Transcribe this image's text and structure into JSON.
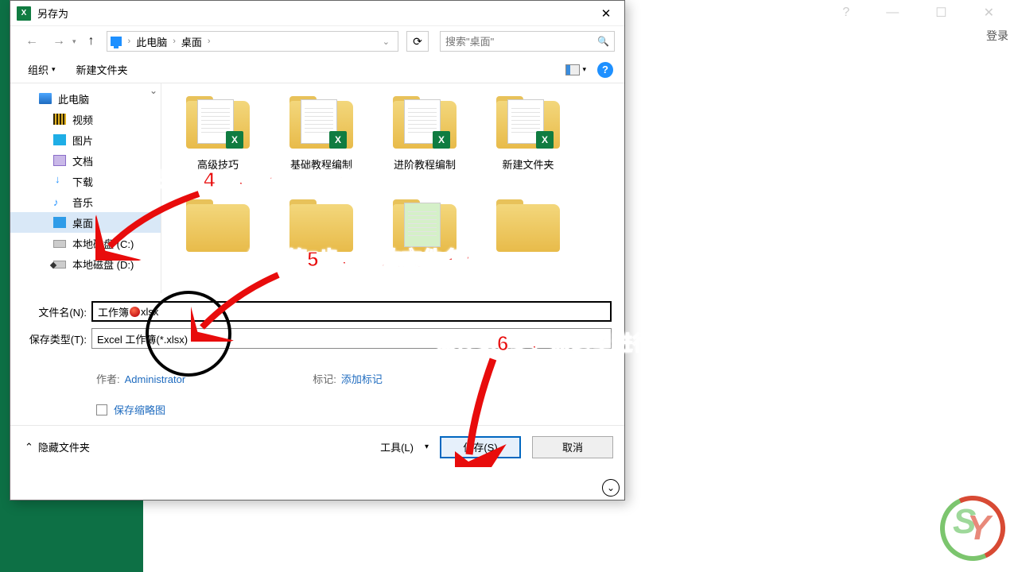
{
  "titlebar": {
    "login": "登录"
  },
  "dialog": {
    "title": "另存为",
    "close": "✕",
    "nav": {
      "back": "←",
      "fwd": "→",
      "up": "↑",
      "crumbs": [
        "此电脑",
        "桌面"
      ],
      "refresh": "⟳",
      "search_placeholder": "搜索\"桌面\"",
      "search_icon": "🔍"
    },
    "toolbar": {
      "organize": "组织",
      "new_folder": "新建文件夹",
      "help": "?"
    },
    "sidebar": {
      "items": [
        {
          "label": "此电脑",
          "icon": "pc"
        },
        {
          "label": "视频",
          "icon": "video"
        },
        {
          "label": "图片",
          "icon": "pic"
        },
        {
          "label": "文档",
          "icon": "doc"
        },
        {
          "label": "下载",
          "icon": "dl"
        },
        {
          "label": "音乐",
          "icon": "music"
        },
        {
          "label": "桌面",
          "icon": "desk",
          "selected": true
        },
        {
          "label": "本地磁盘 (C:)",
          "icon": "diskc"
        },
        {
          "label": "本地磁盘 (D:)",
          "icon": "diskd"
        }
      ]
    },
    "files": [
      {
        "name": "高级技巧",
        "type": "xlfolder"
      },
      {
        "name": "基础教程编制",
        "type": "xlfolder"
      },
      {
        "name": "进阶教程编制",
        "type": "xlfolder"
      },
      {
        "name": "新建文件夹",
        "type": "xlfolder"
      }
    ],
    "form": {
      "filename_label": "文件名(N):",
      "filename_prefix": "工作簿",
      "filename_suffix": "xlsx",
      "type_label": "保存类型(T):",
      "type_value": "Excel 工作簿(*.xlsx)",
      "author_label": "作者:",
      "author_value": "Administrator",
      "tags_label": "标记:",
      "tags_value": "添加标记",
      "thumb_label": "保存缩略图"
    },
    "footer": {
      "hide": "隐藏文件夹",
      "tools": "工具(L)",
      "save": "保存(S)",
      "cancel": "取消"
    }
  },
  "annotations": {
    "step4": "保存第4步，继续选择位置",
    "step5": "保存第5步，修改文件名称",
    "step6": "保存第6步，点这里进行保存"
  }
}
